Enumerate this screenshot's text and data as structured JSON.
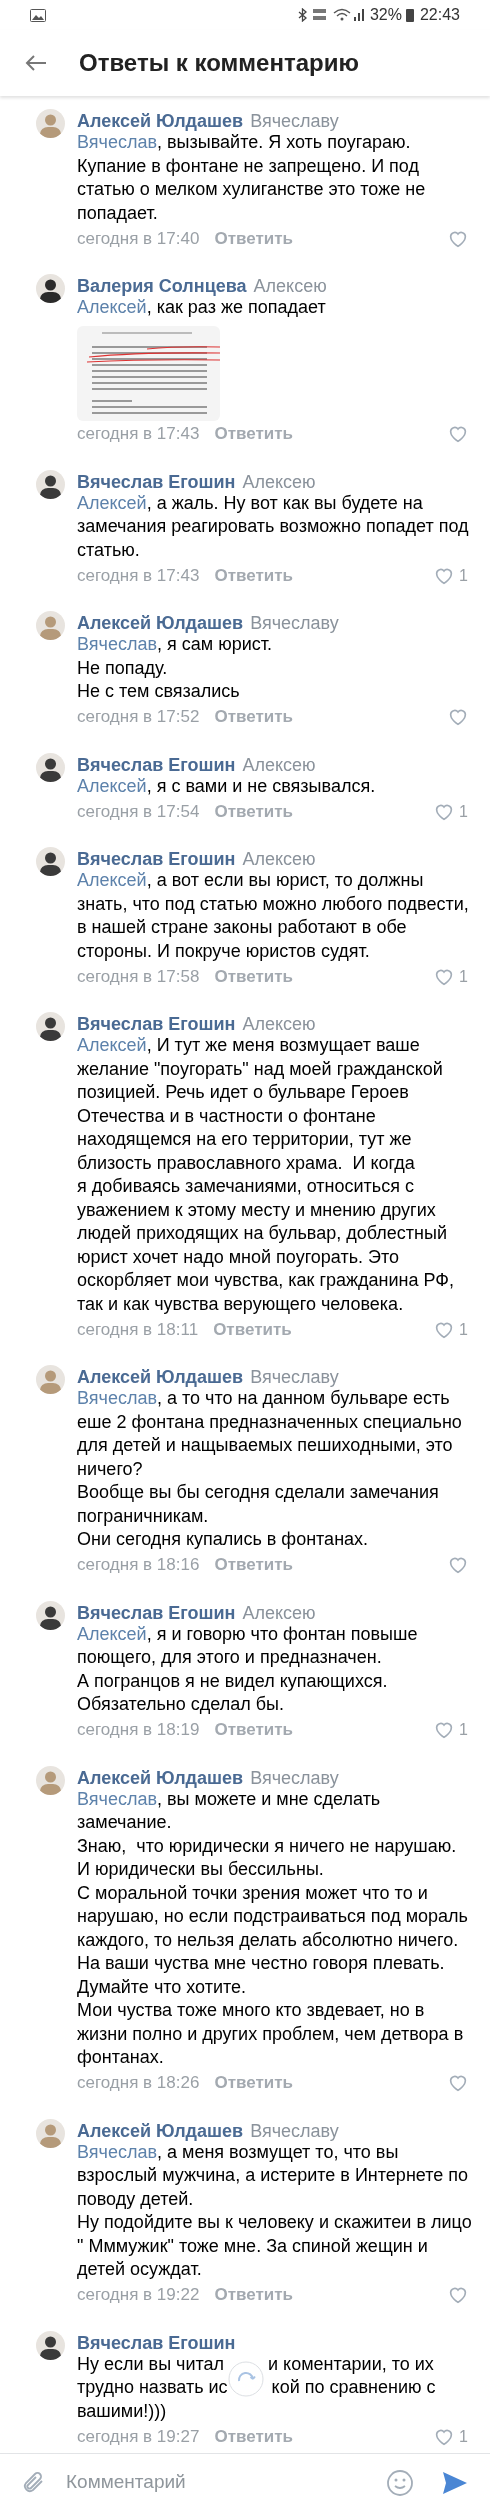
{
  "status_bar": {
    "battery": "32%",
    "time": "22:43"
  },
  "header": {
    "title": "Ответы к комментарию"
  },
  "comments": [
    {
      "author": "Алексей Юлдашев",
      "recipient": "Вячеславу",
      "color": "#b59a7a",
      "mention": "Вячеслав",
      "text": ", вызывайте. Я хоть поугараю. Купание в фонтане не запрещено. И под статью о мелком хулиганстве это тоже не попадает.",
      "time": "сегодня в 17:40",
      "reply": "Ответить"
    },
    {
      "author": "Валерия Солнцева",
      "recipient": "Алексею",
      "color": "#2b2b2b",
      "mention": "Алексей",
      "text": ", как раз же попадает",
      "time": "сегодня в 17:43",
      "reply": "Ответить"
    },
    {
      "author": "Вячеслав Егошин",
      "recipient": "Алексею",
      "color": "#3a3a3a",
      "mention": "Алексей",
      "text": ", а жаль. Ну вот как вы будете на замечания реагировать возможно попадет под статью.",
      "time": "сегодня в 17:43",
      "reply": "Ответить",
      "likes": "1"
    },
    {
      "author": "Алексей Юлдашев",
      "recipient": "Вячеславу",
      "color": "#b59a7a",
      "mention": "Вячеслав",
      "text": ", я сам юрист.\nНе попаду.\nНе с тем связались",
      "time": "сегодня в 17:52",
      "reply": "Ответить"
    },
    {
      "author": "Вячеслав Егошин",
      "recipient": "Алексею",
      "color": "#3a3a3a",
      "mention": "Алексей",
      "text": ", я с вами и не связывался.",
      "time": "сегодня в 17:54",
      "reply": "Ответить",
      "likes": "1"
    },
    {
      "author": "Вячеслав Егошин",
      "recipient": "Алексею",
      "color": "#3a3a3a",
      "mention": "Алексей",
      "text": ", а вот если вы юрист, то должны знать, что под статью можно любого подвести, в нашей стране законы работают в обе стороны. И покруче юристов судят.",
      "time": "сегодня в 17:58",
      "reply": "Ответить",
      "likes": "1"
    },
    {
      "author": "Вячеслав Егошин",
      "recipient": "Алексею",
      "color": "#3a3a3a",
      "mention": "Алексей",
      "text": ", И тут же меня возмущает ваше желание \"поугорать\" над моей гражданской позицией. Речь идет о бульваре Героев Отечества и в частности о фонтане находящемся на его территории, тут же близость православного храма.  И когда\nя добиваясь замечаниями, относиться с уважением к этому месту и мнению других людей приходящих на бульвар, доблестный юрист хочет надо мной поугорать. Это оскорбляет мои чувства, как гражданина РФ, так и как чувства верующего человека.",
      "time": "сегодня в 18:11",
      "reply": "Ответить",
      "likes": "1"
    },
    {
      "author": "Алексей Юлдашев",
      "recipient": "Вячеславу",
      "color": "#b59a7a",
      "mention": "Вячеслав",
      "text": ", а то что на данном бульваре есть еше 2 фонтана предназначенных специально для детей и нащываемых пешиходными, это ничего?\nВообще вы бы сегодня сделали замечания пограничникам.\nОни сегодня купались в фонтанах.",
      "time": "сегодня в 18:16",
      "reply": "Ответить"
    },
    {
      "author": "Вячеслав Егошин",
      "recipient": "Алексею",
      "color": "#3a3a3a",
      "mention": "Алексей",
      "text": ", я и говорю что фонтан повыше поющего, для этого и предназначен.\nА погранцов я не видел купающихся.\nОбязательно сделал бы.",
      "time": "сегодня в 18:19",
      "reply": "Ответить",
      "likes": "1"
    },
    {
      "author": "Алексей Юлдашев",
      "recipient": "Вячеславу",
      "color": "#b59a7a",
      "mention": "Вячеслав",
      "text": ", вы можете и мне сделать\nзамечание.\nЗнаю,  что юридически я ничего не нарушаю.\nИ юридически вы бессильны.\nС моральной точки зрения может что то и нарушаю, но если подстраиваться под мораль каждого, то нельзя делать абсолютно ничего.\nНа ваши чуства мне честно говоря плевать.\nДумайте что хотите.\nМои чуства тоже много кто звдевает, но в жизни полно и других проблем, чем детвора в фонтанах.",
      "time": "сегодня в 18:26",
      "reply": "Ответить"
    },
    {
      "author": "Алексей Юлдашев",
      "recipient": "Вячеславу",
      "color": "#b59a7a",
      "mention": "Вячеслав",
      "text": ", а меня возмущет то, что вы взрослый мужчина, а истерите в Интернете по поводу детей.\nНу подойдите вы к человеку и скажитеи в лицо \" Мммужик\" тоже мне. За спиной жещин и детей осуждат.",
      "time": "сегодня в 19:22",
      "reply": "Ответить"
    },
    {
      "author": "Вячеслав Егошин",
      "color": "#3a3a3a",
      "obscured_lines": [
        {
          "left": "Ну если вы читал",
          "right": "и коментарии, то их"
        },
        {
          "left": "трудно назвать ис",
          "right": "кой по сравнению с"
        },
        {
          "left": "вашими!)))"
        }
      ],
      "time": "сегодня в 19:27",
      "reply": "Ответить",
      "likes": "1"
    }
  ],
  "composer": {
    "placeholder": "Комментарий"
  }
}
